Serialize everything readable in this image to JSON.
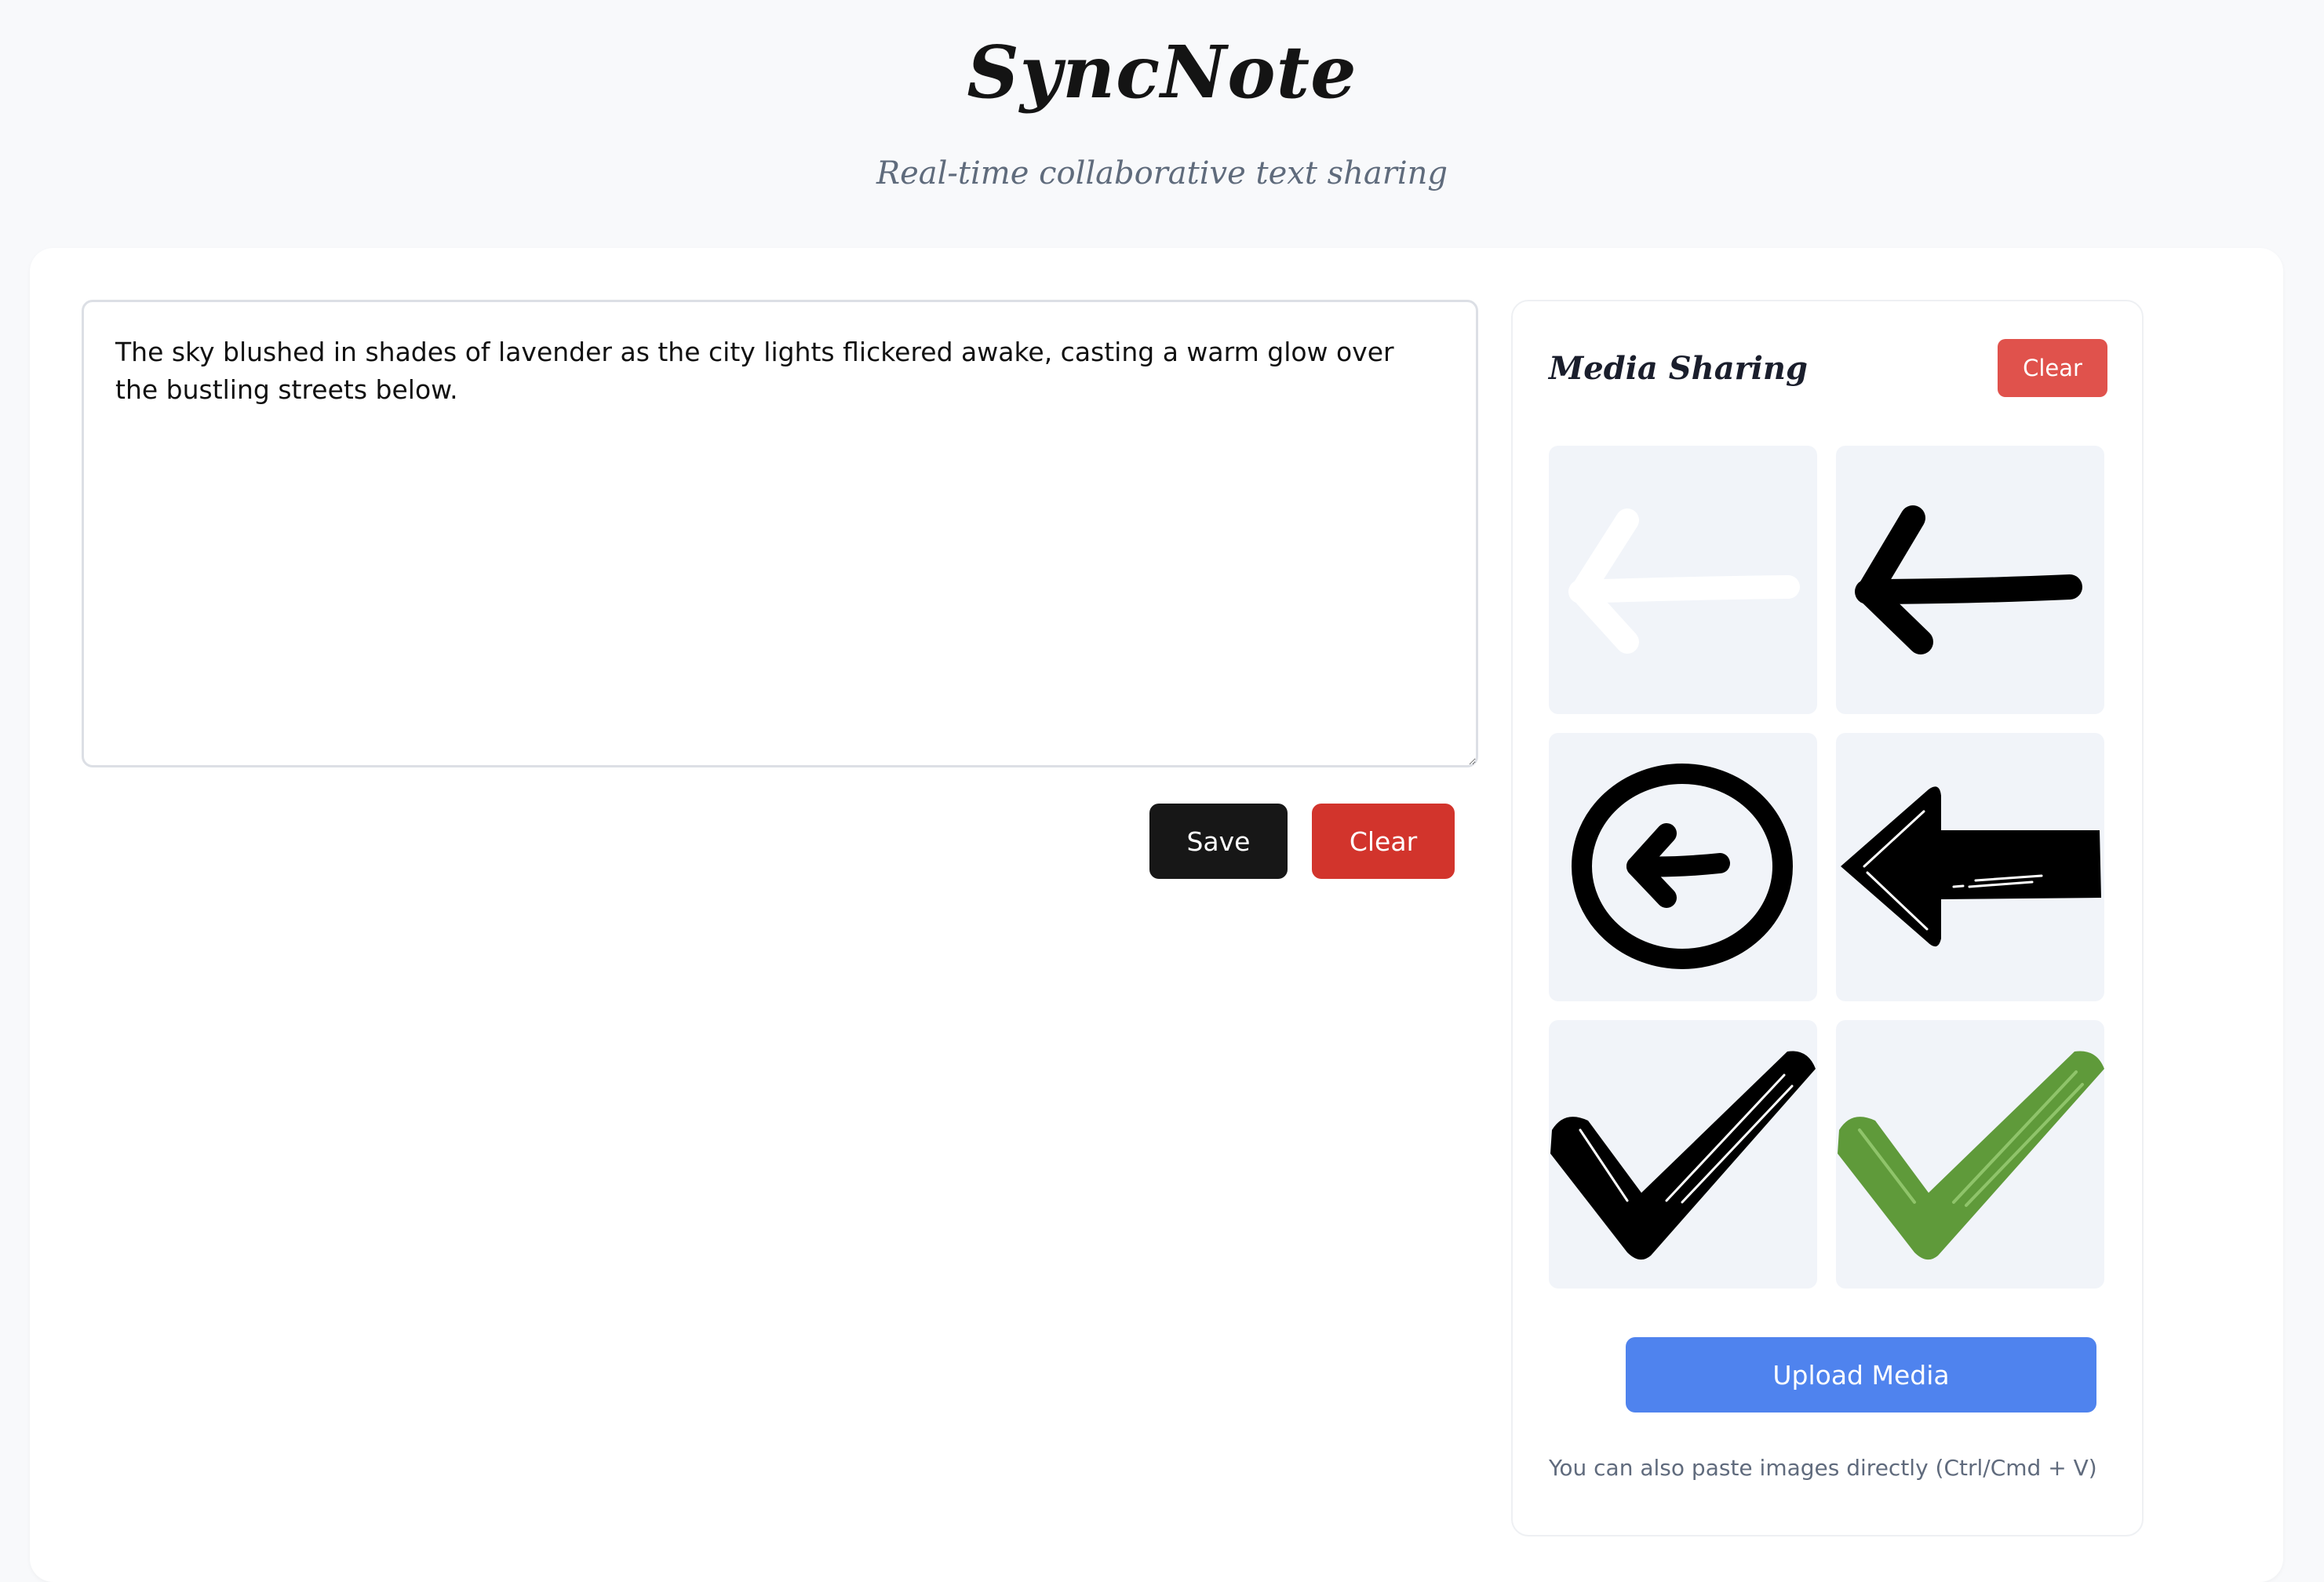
{
  "app": {
    "title": "SyncNote",
    "subtitle": "Real-time collaborative text sharing"
  },
  "editor": {
    "text": "The sky blushed in shades of lavender as the city lights flickered awake, casting a warm glow over the bustling streets below."
  },
  "editor_actions": {
    "save_label": "Save",
    "clear_label": "Clear"
  },
  "media": {
    "title": "Media Sharing",
    "clear_label": "Clear",
    "items": [
      {
        "icon": "white-left-arrow-icon"
      },
      {
        "icon": "black-left-arrow-icon"
      },
      {
        "icon": "circled-left-arrow-icon"
      },
      {
        "icon": "bold-left-arrow-icon"
      },
      {
        "icon": "black-checkmark-icon"
      },
      {
        "icon": "green-checkmark-icon"
      }
    ],
    "upload_label": "Upload Media",
    "paste_hint": "You can also paste images directly (Ctrl/Cmd + V)"
  },
  "colors": {
    "page_background": "#f8f9fb",
    "card_background": "#ffffff",
    "tile_background": "#f1f4f9",
    "save_button": "#171717",
    "clear_button": "#d2342c",
    "media_clear_button": "#e0524c",
    "upload_button": "#4f83ee",
    "check_green": "#5f9a3a"
  }
}
